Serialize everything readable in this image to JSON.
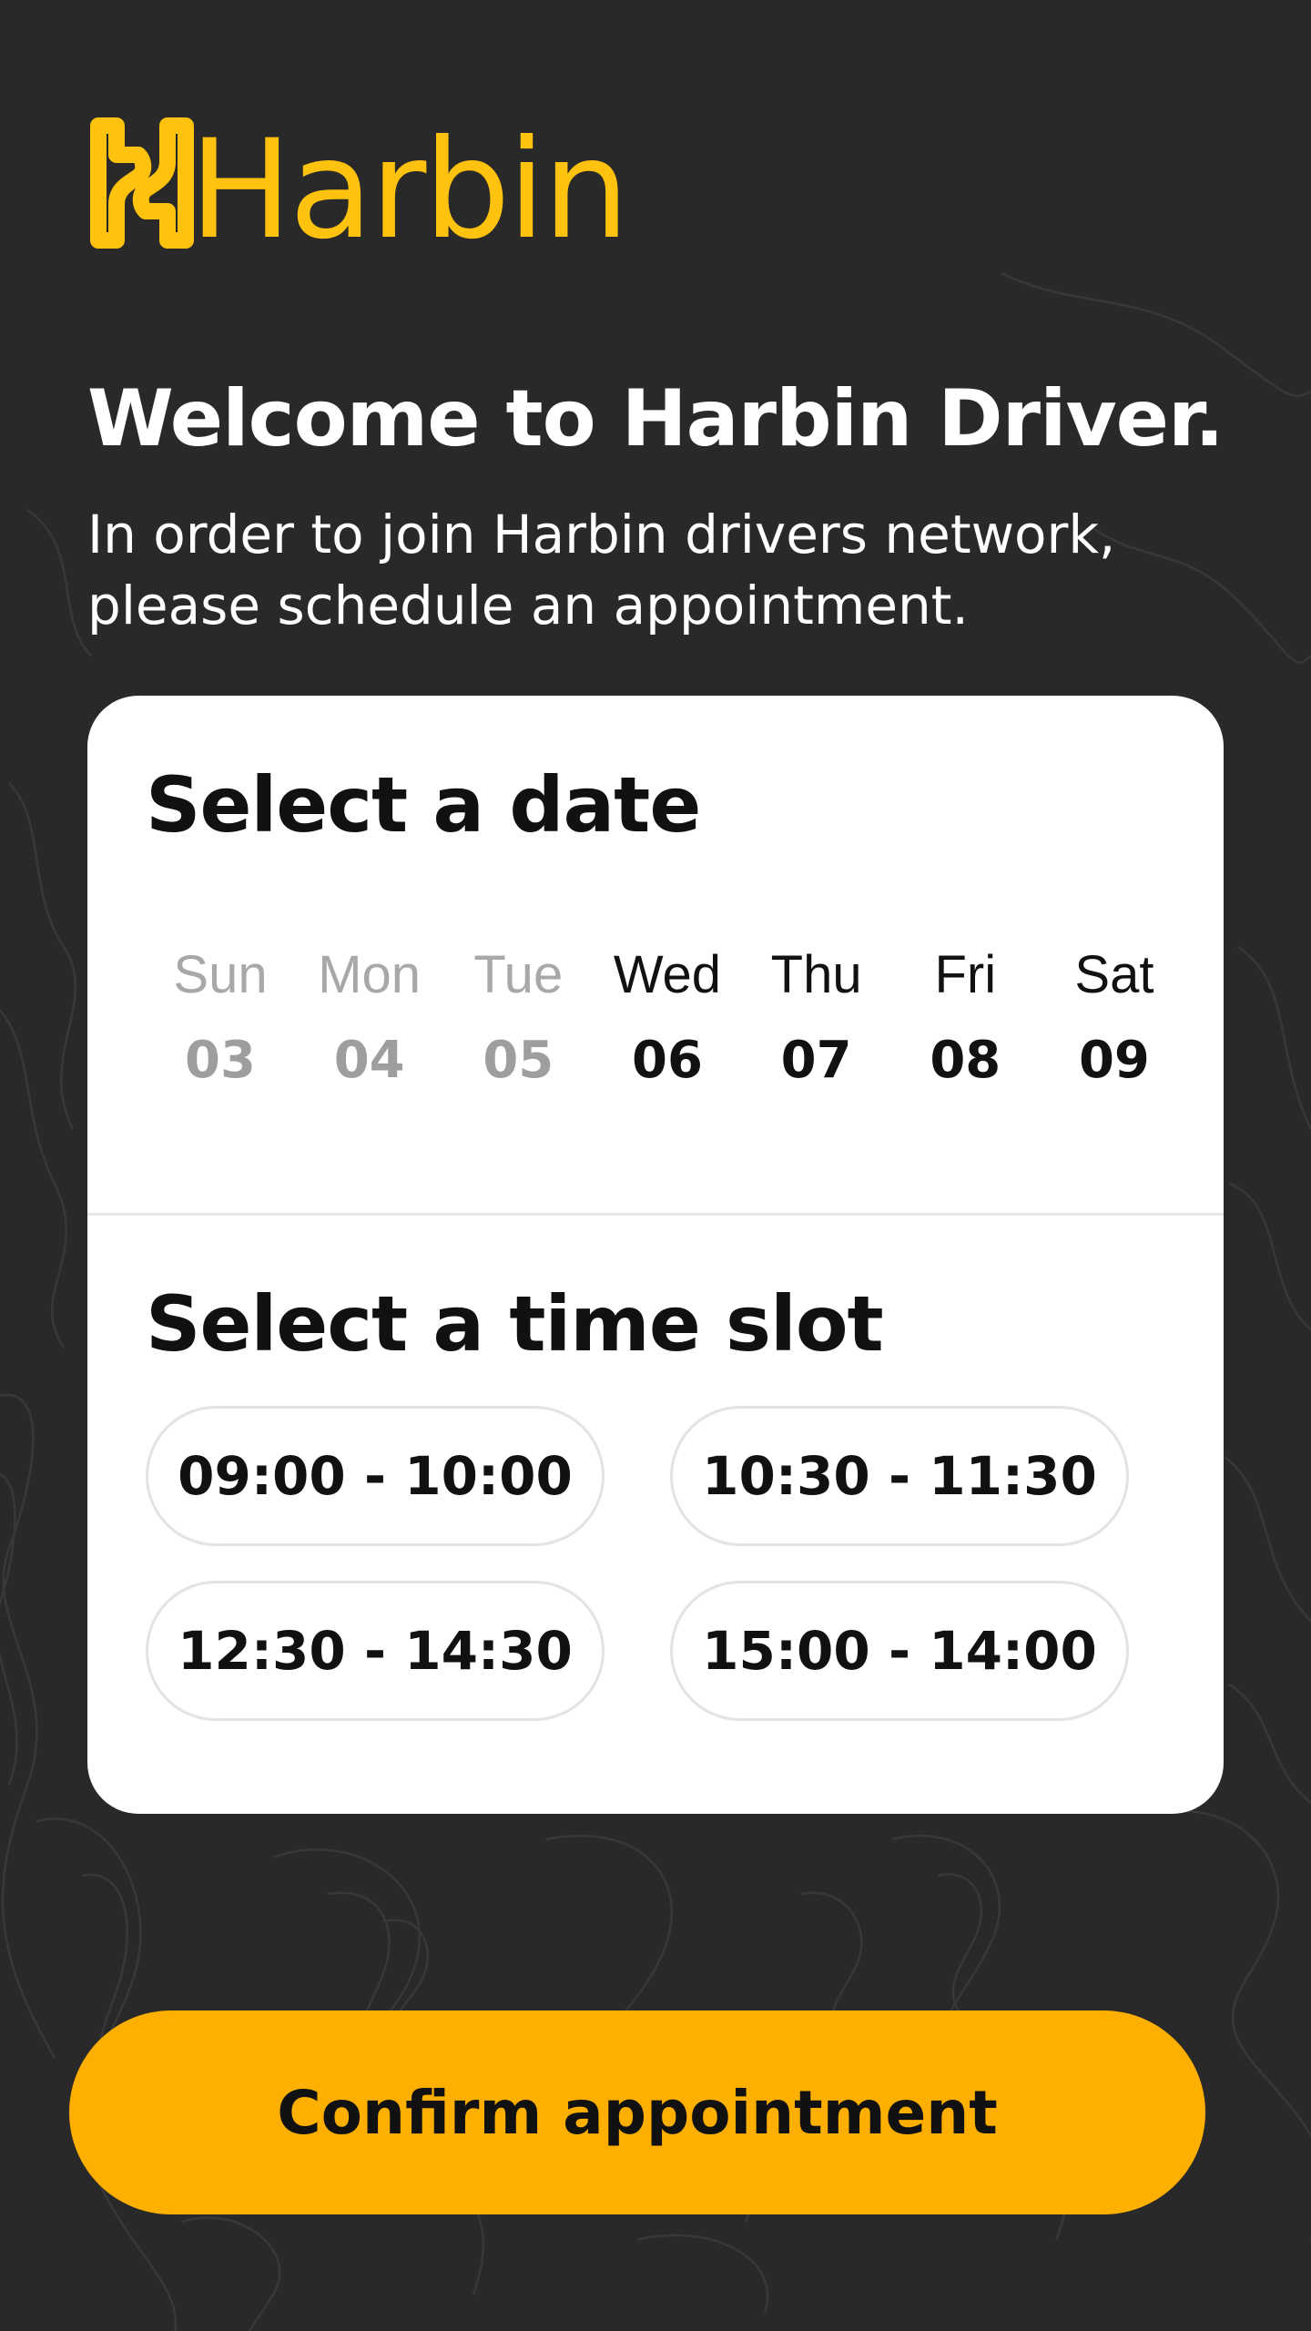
{
  "colors": {
    "background": "#292929",
    "brand": "#FFC20E",
    "accent": "#FFAF00",
    "card": "#FFFFFF",
    "text_dark": "#111111",
    "text_light": "#FFFFFF",
    "text_disabled": "#A8A8A8"
  },
  "brand": {
    "name": "Harbin",
    "logo_icon": "harbin-h-logo-icon"
  },
  "welcome": {
    "title": "Welcome to Harbin Driver.",
    "subtitle": "In order to join Harbin drivers network, please schedule an appointment."
  },
  "date_section": {
    "title": "Select a date",
    "days": [
      {
        "name": "Sun",
        "number": "03",
        "available": false
      },
      {
        "name": "Mon",
        "number": "04",
        "available": false
      },
      {
        "name": "Tue",
        "number": "05",
        "available": false
      },
      {
        "name": "Wed",
        "number": "06",
        "available": true
      },
      {
        "name": "Thu",
        "number": "07",
        "available": true
      },
      {
        "name": "Fri",
        "number": "08",
        "available": true
      },
      {
        "name": "Sat",
        "number": "09",
        "available": true
      }
    ]
  },
  "time_section": {
    "title": "Select a time slot",
    "slots": [
      "09:00 - 10:00",
      "10:30 - 11:30",
      "12:30 - 14:30",
      "15:00 - 14:00"
    ]
  },
  "confirm_button": {
    "label": "Confirm appointment"
  }
}
